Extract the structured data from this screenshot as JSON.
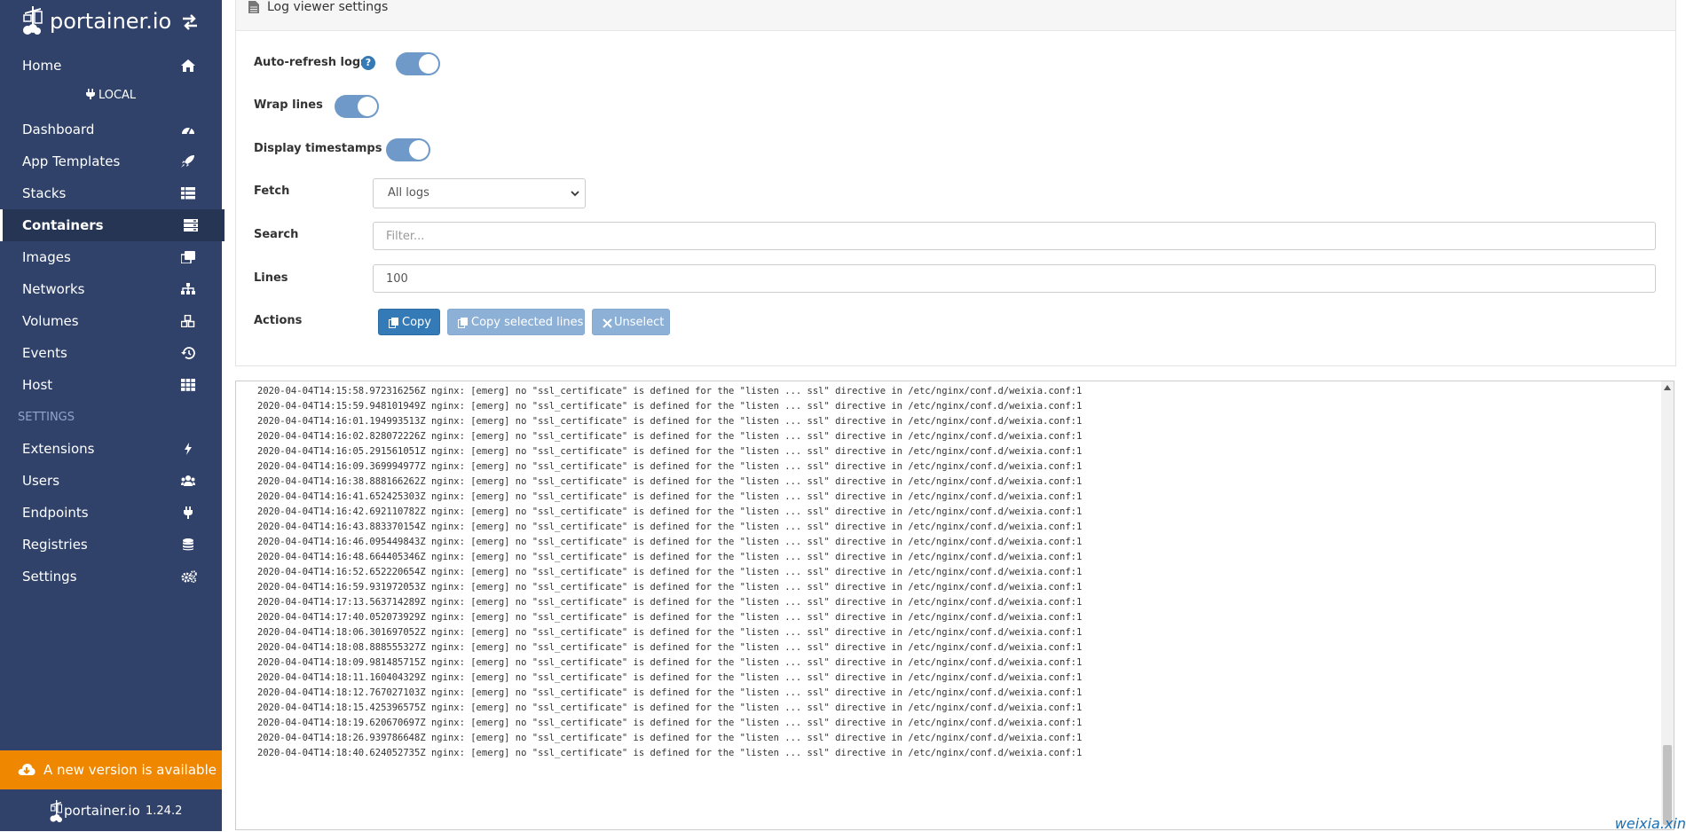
{
  "sidebar": {
    "brand": "portainer.io",
    "items_top": [
      {
        "label": "Home",
        "icon": "home-icon"
      }
    ],
    "endpoint": "LOCAL",
    "items_endpoint": [
      {
        "label": "Dashboard",
        "icon": "tachometer-icon"
      },
      {
        "label": "App Templates",
        "icon": "rocket-icon"
      },
      {
        "label": "Stacks",
        "icon": "th-list-icon"
      },
      {
        "label": "Containers",
        "icon": "server-icon",
        "active": true
      },
      {
        "label": "Images",
        "icon": "clone-icon"
      },
      {
        "label": "Networks",
        "icon": "sitemap-icon"
      },
      {
        "label": "Volumes",
        "icon": "cubes-icon"
      },
      {
        "label": "Events",
        "icon": "history-icon"
      },
      {
        "label": "Host",
        "icon": "th-icon"
      }
    ],
    "settings_header": "SETTINGS",
    "items_settings": [
      {
        "label": "Extensions",
        "icon": "bolt-icon"
      },
      {
        "label": "Users",
        "icon": "users-icon"
      },
      {
        "label": "Endpoints",
        "icon": "plug-icon"
      },
      {
        "label": "Registries",
        "icon": "database-icon"
      },
      {
        "label": "Settings",
        "icon": "cogs-icon"
      }
    ],
    "update_banner": "A new version is available",
    "footer": {
      "name": "portainer.io",
      "version": "1.24.2"
    }
  },
  "settings_panel": {
    "title": "Log viewer settings",
    "auto_refresh_label": "Auto-refresh logs",
    "auto_refresh_on": true,
    "wrap_lines_label": "Wrap lines",
    "wrap_lines_on": true,
    "timestamps_label": "Display timestamps",
    "timestamps_on": true,
    "fetch_label": "Fetch",
    "fetch_value": "All logs",
    "search_label": "Search",
    "search_placeholder": "Filter...",
    "lines_label": "Lines",
    "lines_value": "100",
    "actions_label": "Actions",
    "copy_label": "Copy",
    "copy_selected_label": "Copy selected lines",
    "unselect_label": "Unselect"
  },
  "log_message": "nginx: [emerg] no \"ssl_certificate\" is defined for the \"listen ... ssl\" directive in /etc/nginx/conf.d/weixia.conf:1",
  "log_timestamps": [
    "2020-04-04T14:15:58.972316256Z",
    "2020-04-04T14:15:59.948101949Z",
    "2020-04-04T14:16:01.194993513Z",
    "2020-04-04T14:16:02.828072226Z",
    "2020-04-04T14:16:05.291561051Z",
    "2020-04-04T14:16:09.369994977Z",
    "2020-04-04T14:16:38.888166262Z",
    "2020-04-04T14:16:41.652425303Z",
    "2020-04-04T14:16:42.692110782Z",
    "2020-04-04T14:16:43.883370154Z",
    "2020-04-04T14:16:46.095449843Z",
    "2020-04-04T14:16:48.664405346Z",
    "2020-04-04T14:16:52.652220654Z",
    "2020-04-04T14:16:59.931972053Z",
    "2020-04-04T14:17:13.563714289Z",
    "2020-04-04T14:17:40.052073929Z",
    "2020-04-04T14:18:06.301697052Z",
    "2020-04-04T14:18:08.888555327Z",
    "2020-04-04T14:18:09.981485715Z",
    "2020-04-04T14:18:11.160404329Z",
    "2020-04-04T14:18:12.767027103Z",
    "2020-04-04T14:18:15.425396575Z",
    "2020-04-04T14:18:19.620670697Z",
    "2020-04-04T14:18:26.939786648Z",
    "2020-04-04T14:18:40.624052735Z"
  ],
  "watermark": "weixia.xin",
  "colors": {
    "sidebar_bg": "#30426a",
    "sidebar_active_bg": "#253553",
    "accent": "#337ab7",
    "toggle_on": "#6e99c8",
    "banner": "#f08700"
  }
}
